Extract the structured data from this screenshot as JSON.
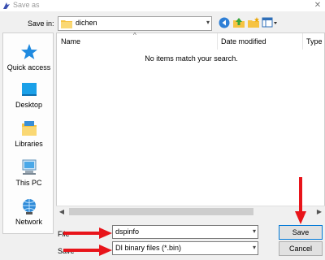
{
  "window": {
    "title": "Save as",
    "close_glyph": "✕"
  },
  "toolbar": {
    "save_in_label": "Save in:",
    "save_in_value": "dichen",
    "icons": [
      "back-icon",
      "up-folder-icon",
      "new-folder-icon",
      "view-menu-icon"
    ]
  },
  "places": [
    {
      "label": "Quick access",
      "icon": "star-icon"
    },
    {
      "label": "Desktop",
      "icon": "desktop-icon"
    },
    {
      "label": "Libraries",
      "icon": "libraries-icon"
    },
    {
      "label": "This PC",
      "icon": "pc-icon"
    },
    {
      "label": "Network",
      "icon": "network-icon"
    }
  ],
  "file_list": {
    "columns": [
      "Name",
      "Date modified",
      "Type"
    ],
    "empty_message": "No items match your search."
  },
  "file_name": {
    "label": "File",
    "value": "dspinfo"
  },
  "save_as_type": {
    "label": "Save",
    "value": "DI binary files (*.bin)"
  },
  "buttons": {
    "save": "Save",
    "cancel": "Cancel"
  },
  "colors": {
    "annotation": "#e8141a",
    "folder": "#f6c342",
    "accent": "#0078d7"
  }
}
